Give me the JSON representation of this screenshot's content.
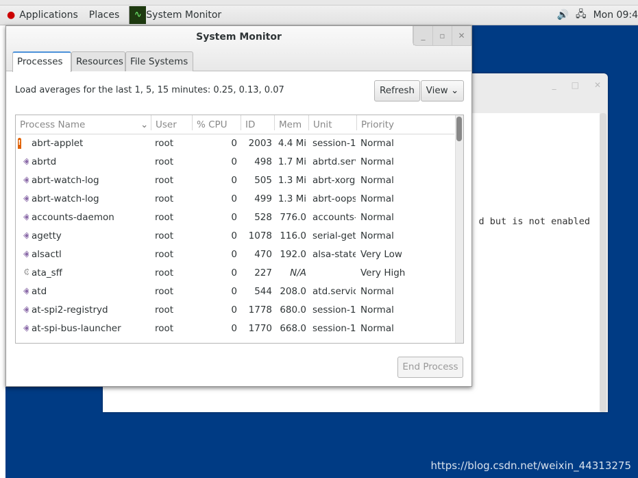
{
  "panel": {
    "applications": "Applications",
    "places": "Places",
    "task": "System Monitor",
    "clock": "Mon 09:4"
  },
  "background_window": {
    "text": "d but is not enabled"
  },
  "window": {
    "title": "System Monitor",
    "tabs": [
      "Processes",
      "Resources",
      "File Systems"
    ],
    "load_text": "Load averages for the last 1, 5, 15 minutes: 0.25, 0.13, 0.07",
    "refresh": "Refresh",
    "view": "View",
    "end_process": "End Process",
    "columns": [
      "Process Name",
      "User",
      "% CPU",
      "ID",
      "Mem",
      "Unit",
      "Priority"
    ],
    "rows": [
      {
        "icon": "alarm-icon",
        "name": "abrt-applet",
        "user": "root",
        "cpu": "0",
        "id": "2003",
        "mem": "4.4 Mi",
        "unit": "session-1",
        "priority": "Normal"
      },
      {
        "icon": "process-icon",
        "name": "abrtd",
        "user": "root",
        "cpu": "0",
        "id": "498",
        "mem": "1.7 Mi",
        "unit": "abrtd.serv",
        "priority": "Normal"
      },
      {
        "icon": "process-icon",
        "name": "abrt-watch-log",
        "user": "root",
        "cpu": "0",
        "id": "505",
        "mem": "1.3 Mi",
        "unit": "abrt-xorg",
        "priority": "Normal"
      },
      {
        "icon": "process-icon",
        "name": "abrt-watch-log",
        "user": "root",
        "cpu": "0",
        "id": "499",
        "mem": "1.3 Mi",
        "unit": "abrt-oops",
        "priority": "Normal"
      },
      {
        "icon": "process-icon",
        "name": "accounts-daemon",
        "user": "root",
        "cpu": "0",
        "id": "528",
        "mem": "776.0",
        "unit": "accounts-",
        "priority": "Normal"
      },
      {
        "icon": "process-icon",
        "name": "agetty",
        "user": "root",
        "cpu": "0",
        "id": "1078",
        "mem": "116.0",
        "unit": "serial-get",
        "priority": "Normal"
      },
      {
        "icon": "process-icon",
        "name": "alsactl",
        "user": "root",
        "cpu": "0",
        "id": "470",
        "mem": "192.0",
        "unit": "alsa-state",
        "priority": "Very Low"
      },
      {
        "icon": "gear-icon",
        "name": "ata_sff",
        "user": "root",
        "cpu": "0",
        "id": "227",
        "mem": "N/A",
        "unit": "",
        "priority": "Very High"
      },
      {
        "icon": "process-icon",
        "name": "atd",
        "user": "root",
        "cpu": "0",
        "id": "544",
        "mem": "208.0",
        "unit": "atd.servic",
        "priority": "Normal"
      },
      {
        "icon": "process-icon",
        "name": "at-spi2-registryd",
        "user": "root",
        "cpu": "0",
        "id": "1778",
        "mem": "680.0",
        "unit": "session-1",
        "priority": "Normal"
      },
      {
        "icon": "process-icon",
        "name": "at-spi-bus-launcher",
        "user": "root",
        "cpu": "0",
        "id": "1770",
        "mem": "668.0",
        "unit": "session-1",
        "priority": "Normal"
      }
    ]
  },
  "watermark": "https://blog.csdn.net/weixin_44313275"
}
